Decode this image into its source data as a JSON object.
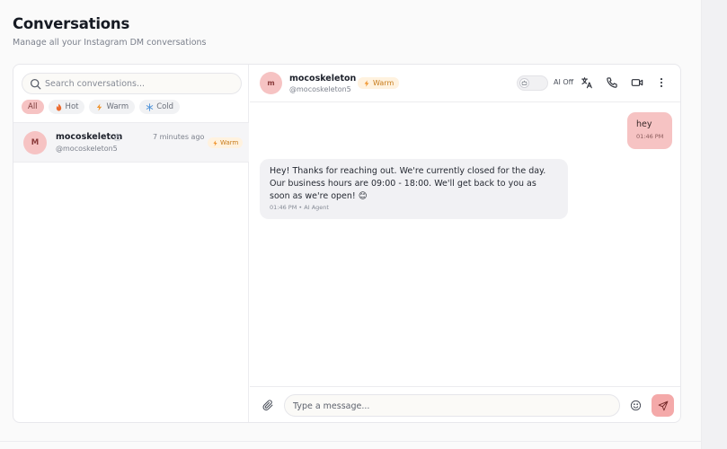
{
  "page": {
    "title": "Conversations",
    "subtitle": "Manage all your Instagram DM conversations"
  },
  "search": {
    "placeholder": "Search conversations...",
    "value": "",
    "icon": "search-icon"
  },
  "filters": [
    {
      "label": "All",
      "icon": "",
      "active": true
    },
    {
      "label": "Hot",
      "icon": "flame-icon",
      "active": false
    },
    {
      "label": "Warm",
      "icon": "bolt-icon",
      "active": false
    },
    {
      "label": "Cold",
      "icon": "snowflake-icon",
      "active": false
    }
  ],
  "conversations": [
    {
      "initial": "M",
      "name": "mocoskeleton",
      "handle": "@mocoskeleton5",
      "time": "7 minutes ago",
      "badge": "Warm"
    }
  ],
  "chat": {
    "initial": "m",
    "name": "mocoskeleton",
    "handle": "@mocoskeleton5",
    "badge": "Warm",
    "ai_label": "AI Off",
    "ai_enabled": false,
    "header_icons": [
      "translate-icon",
      "phone-icon",
      "video-icon",
      "more-vertical-icon"
    ],
    "messages": [
      {
        "direction": "outgoing",
        "text": "hey",
        "meta": "01:46 PM"
      },
      {
        "direction": "incoming",
        "text": "Hey! Thanks for reaching out. We're currently closed for the day. Our business hours are 09:00 - 18:00. We'll get back to you as soon as we're open! 😊",
        "meta": "01:46 PM • AI Agent"
      }
    ]
  },
  "composer": {
    "placeholder": "Type a message...",
    "value": ""
  },
  "colors": {
    "accent": "#f6c3c3",
    "send": "#f4a9a9",
    "warm_badge_bg": "#fff2df",
    "warm_badge_text": "#c77b1a"
  }
}
